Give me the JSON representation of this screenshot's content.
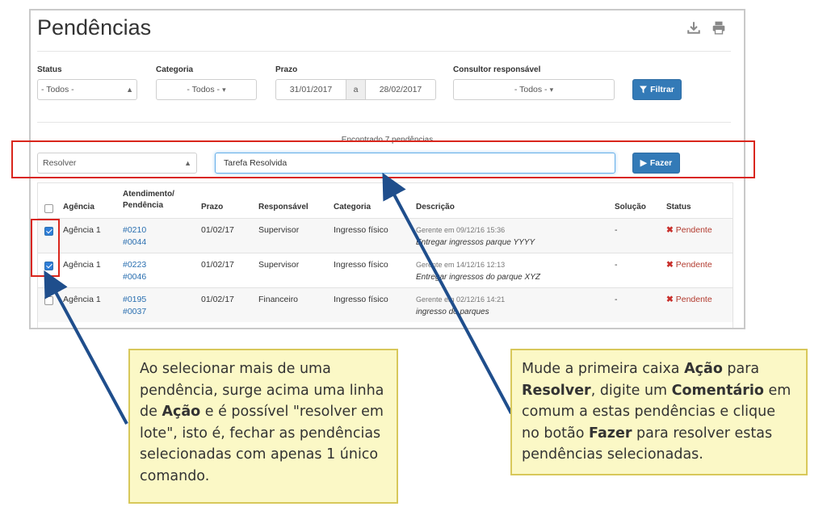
{
  "page": {
    "title": "Pendências",
    "download_icon": "download-icon",
    "print_icon": "print-icon"
  },
  "filters": {
    "status": {
      "label": "Status",
      "value": "- Todos -"
    },
    "categoria": {
      "label": "Categoria",
      "value": "- Todos -"
    },
    "prazo": {
      "label": "Prazo",
      "from": "31/01/2017",
      "separator": "a",
      "to": "28/02/2017"
    },
    "consultor": {
      "label": "Consultor responsável",
      "value": "- Todos -"
    },
    "filter_button": "Filtrar"
  },
  "result_text": "Encontrado 7 pendências",
  "action_row": {
    "action_value": "Resolver",
    "comment_value": "Tarefa Resolvida",
    "submit_button": "Fazer"
  },
  "table": {
    "headers": {
      "agencia": "Agência",
      "atendimento_1": "Atendimento/",
      "atendimento_2": "Pendência",
      "prazo": "Prazo",
      "responsavel": "Responsável",
      "categoria": "Categoria",
      "descricao": "Descrição",
      "solucao": "Solução",
      "status": "Status"
    },
    "rows": [
      {
        "checked": true,
        "agencia": "Agência 1",
        "atendimento": "#0210",
        "pendencia": "#0044",
        "prazo": "01/02/17",
        "responsavel": "Supervisor",
        "categoria": "Ingresso físico",
        "desc_meta": "Gerente em 09/12/16 15:36",
        "desc_text": "Entregar ingressos parque YYYY",
        "solucao": "-",
        "status": "Pendente"
      },
      {
        "checked": true,
        "agencia": "Agência 1",
        "atendimento": "#0223",
        "pendencia": "#0046",
        "prazo": "01/02/17",
        "responsavel": "Supervisor",
        "categoria": "Ingresso físico",
        "desc_meta": "Gerente em 14/12/16 12:13",
        "desc_text": "Entregar ingressos do parque XYZ",
        "solucao": "-",
        "status": "Pendente"
      },
      {
        "checked": false,
        "agencia": "Agência 1",
        "atendimento": "#0195",
        "pendencia": "#0037",
        "prazo": "01/02/17",
        "responsavel": "Financeiro",
        "categoria": "Ingresso físico",
        "desc_meta": "Gerente em 02/12/16 14:21",
        "desc_text": "ingresso do parques",
        "solucao": "-",
        "status": "Pendente"
      }
    ]
  },
  "callouts": {
    "left": {
      "p1": "Ao selecionar mais de uma pendência, surge acima uma linha de ",
      "b1": "Ação",
      "p2": " e é possível \"resolver em lote\", isto é, fechar as pendências selecionadas com apenas 1 único comando."
    },
    "right": {
      "p1": "Mude a primeira caixa ",
      "b1": "Ação",
      "p2": " para ",
      "b2": "Resolver",
      "p3": ", digite um ",
      "b3": "Comentário",
      "p4": " em comum a estas pendências e clique no botão ",
      "b4": "Fazer",
      "p5": " para resolver estas pendências selecionadas."
    }
  },
  "colors": {
    "accent_blue": "#337ab7",
    "annotation_red": "#d9261c",
    "callout_fill": "#fbf8c6",
    "arrow_blue": "#1f4e8c"
  }
}
